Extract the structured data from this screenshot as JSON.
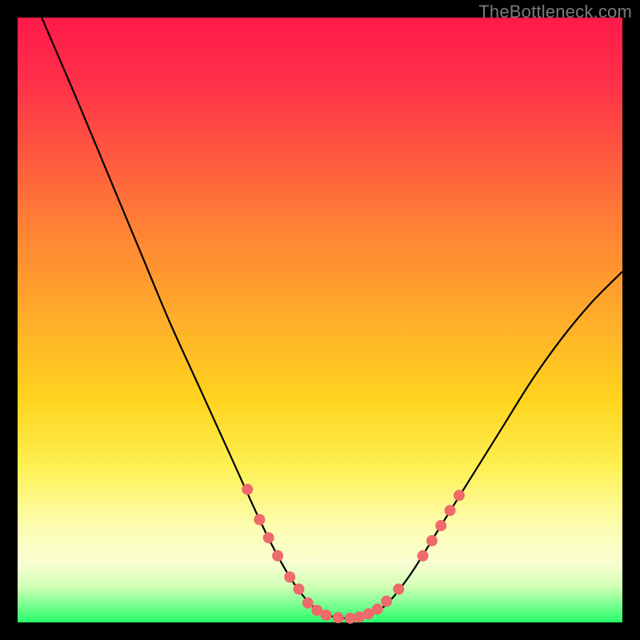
{
  "watermark": "TheBottleneck.com",
  "chart_data": {
    "type": "line",
    "title": "",
    "xlabel": "",
    "ylabel": "",
    "xlim": [
      0,
      100
    ],
    "ylim": [
      0,
      100
    ],
    "series": [
      {
        "name": "bottleneck-curve",
        "x": [
          4,
          10,
          15,
          20,
          25,
          30,
          35,
          40,
          43,
          46,
          49,
          52,
          55,
          58,
          61,
          65,
          70,
          75,
          80,
          85,
          90,
          95,
          100
        ],
        "values": [
          100,
          86,
          74,
          62,
          50,
          39,
          28,
          17,
          11,
          6,
          2.5,
          1,
          0.7,
          1.2,
          3,
          8,
          16,
          24,
          32,
          40,
          47,
          53,
          58
        ]
      }
    ],
    "markers": [
      {
        "name": "left-arm-marker",
        "curve_x": 38,
        "curve_y": 22
      },
      {
        "name": "left-arm-marker",
        "curve_x": 40,
        "curve_y": 17
      },
      {
        "name": "left-arm-marker",
        "curve_x": 41.5,
        "curve_y": 14
      },
      {
        "name": "left-arm-marker",
        "curve_x": 43,
        "curve_y": 11
      },
      {
        "name": "left-arm-marker",
        "curve_x": 45,
        "curve_y": 7.5
      },
      {
        "name": "left-arm-marker",
        "curve_x": 46.5,
        "curve_y": 5.5
      },
      {
        "name": "valley-marker",
        "curve_x": 48,
        "curve_y": 3.2
      },
      {
        "name": "valley-marker",
        "curve_x": 49.5,
        "curve_y": 2
      },
      {
        "name": "valley-marker",
        "curve_x": 51,
        "curve_y": 1.2
      },
      {
        "name": "valley-marker",
        "curve_x": 53,
        "curve_y": 0.8
      },
      {
        "name": "valley-marker",
        "curve_x": 55,
        "curve_y": 0.7
      },
      {
        "name": "valley-marker",
        "curve_x": 56.5,
        "curve_y": 0.9
      },
      {
        "name": "valley-marker",
        "curve_x": 58,
        "curve_y": 1.4
      },
      {
        "name": "valley-marker",
        "curve_x": 59.5,
        "curve_y": 2.2
      },
      {
        "name": "right-arm-marker",
        "curve_x": 61,
        "curve_y": 3.5
      },
      {
        "name": "right-arm-marker",
        "curve_x": 63,
        "curve_y": 5.5
      },
      {
        "name": "right-arm-marker",
        "curve_x": 67,
        "curve_y": 11
      },
      {
        "name": "right-arm-marker",
        "curve_x": 68.5,
        "curve_y": 13.5
      },
      {
        "name": "right-arm-marker",
        "curve_x": 70,
        "curve_y": 16
      },
      {
        "name": "right-arm-marker",
        "curve_x": 71.5,
        "curve_y": 18.5
      },
      {
        "name": "right-arm-marker",
        "curve_x": 73,
        "curve_y": 21
      }
    ],
    "colors": {
      "curve_stroke": "#000000",
      "marker_fill": "#ef6a6a"
    }
  }
}
